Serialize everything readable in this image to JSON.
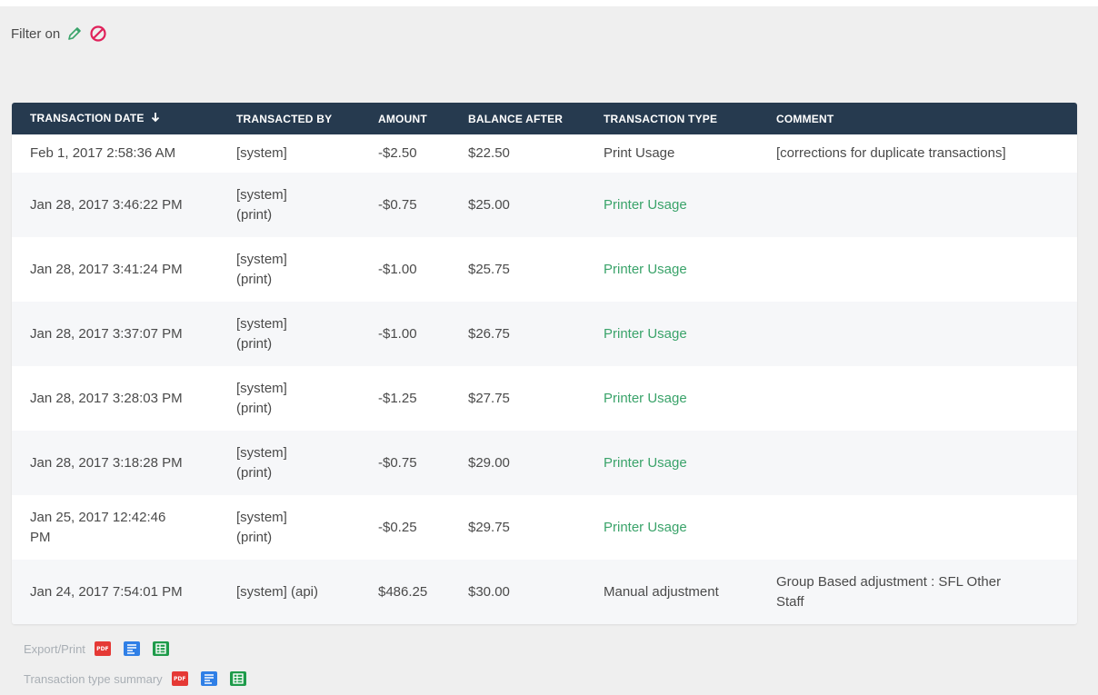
{
  "filter": {
    "label": "Filter on"
  },
  "table": {
    "columns": [
      "TRANSACTION DATE",
      "TRANSACTED BY",
      "AMOUNT",
      "BALANCE AFTER",
      "TRANSACTION TYPE",
      "COMMENT"
    ],
    "rows": [
      {
        "date": "Feb 1, 2017 2:58:36 AM",
        "by": [
          "[system]"
        ],
        "amount": "-$2.50",
        "balance": "$22.50",
        "type": "Print Usage",
        "comment": "[corrections for duplicate transactions]"
      },
      {
        "date": "Jan 28, 2017 3:46:22 PM",
        "by": [
          "[system]",
          "(print)"
        ],
        "amount": "-$0.75",
        "balance": "$25.00",
        "type": "Printer Usage",
        "comment": ""
      },
      {
        "date": "Jan 28, 2017 3:41:24 PM",
        "by": [
          "[system]",
          "(print)"
        ],
        "amount": "-$1.00",
        "balance": "$25.75",
        "type": "Printer Usage",
        "comment": ""
      },
      {
        "date": "Jan 28, 2017 3:37:07 PM",
        "by": [
          "[system]",
          "(print)"
        ],
        "amount": "-$1.00",
        "balance": "$26.75",
        "type": "Printer Usage",
        "comment": ""
      },
      {
        "date": "Jan 28, 2017 3:28:03 PM",
        "by": [
          "[system]",
          "(print)"
        ],
        "amount": "-$1.25",
        "balance": "$27.75",
        "type": "Printer Usage",
        "comment": ""
      },
      {
        "date": "Jan 28, 2017 3:18:28 PM",
        "by": [
          "[system]",
          "(print)"
        ],
        "amount": "-$0.75",
        "balance": "$29.00",
        "type": "Printer Usage",
        "comment": ""
      },
      {
        "date": [
          "Jan 25, 2017 12:42:46",
          "PM"
        ],
        "by": [
          "[system]",
          "(print)"
        ],
        "amount": "-$0.25",
        "balance": "$29.75",
        "type": "Printer Usage",
        "comment": ""
      },
      {
        "date": "Jan 24, 2017 7:54:01 PM",
        "by": [
          "[system] (api)"
        ],
        "amount": "$486.25",
        "balance": "$30.00",
        "type": "Manual adjustment",
        "comment": [
          "Group Based adjustment : SFL Other",
          "Staff"
        ]
      }
    ]
  },
  "footer": {
    "export_label": "Export/Print",
    "summary_label": "Transaction type summary",
    "pdf_icon_text": "PDF",
    "icons": [
      "pdf-icon",
      "document-icon",
      "spreadsheet-icon"
    ]
  },
  "colors": {
    "header_bg": "#263a4f",
    "printer_usage_text": "#3aa36a",
    "edit_icon": "#3aa36a",
    "clear_icon": "#e0215a"
  }
}
